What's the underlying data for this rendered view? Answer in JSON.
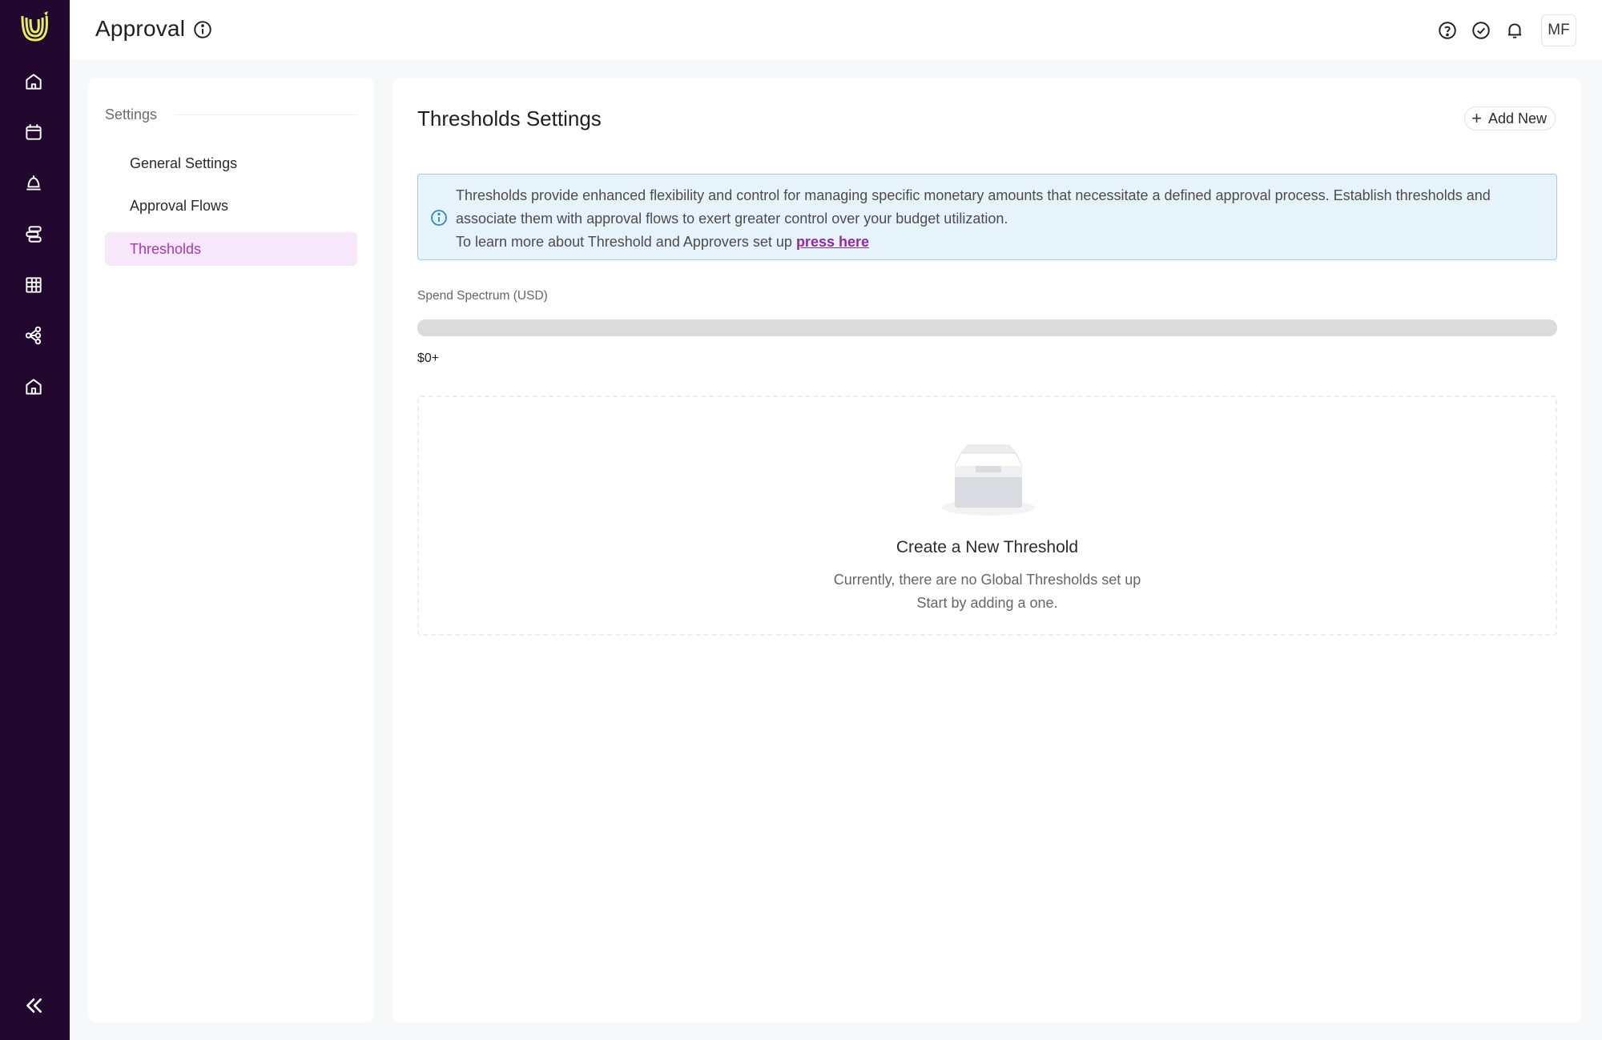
{
  "header": {
    "title": "Approval",
    "avatar_initials": "MF"
  },
  "sidebar": {
    "nav_icons": [
      "home-icon",
      "calendar-icon",
      "bell-stand-icon",
      "stacked-cards-icon",
      "table-icon",
      "share-nodes-icon",
      "building-home-icon"
    ],
    "collapse_icon": "double-chevron-left-icon"
  },
  "settings": {
    "heading": "Settings",
    "items": [
      {
        "label": "General Settings",
        "active": false
      },
      {
        "label": "Approval Flows",
        "active": false
      },
      {
        "label": "Thresholds",
        "active": true
      }
    ]
  },
  "main": {
    "title": "Thresholds Settings",
    "add_button_label": "Add New",
    "info": {
      "line1": "Thresholds provide enhanced flexibility and control for managing specific monetary amounts that necessitate a defined approval process. Establish thresholds and associate them with approval flows to exert greater control over your budget utilization.",
      "line2_prefix": "To learn more about Threshold and Approvers set up ",
      "link_text": "press here"
    },
    "spectrum": {
      "label": "Spend Spectrum (USD)",
      "min_label": "$0+"
    },
    "empty_state": {
      "title": "Create a New Threshold",
      "line1": "Currently, there are no Global Thresholds set up",
      "line2": "Start by adding a one."
    }
  },
  "colors": {
    "rail": "#22082f",
    "accent": "#a33bb2",
    "active_bg": "#f6e7fb",
    "info_bg": "#e7f3fb",
    "info_border": "#9ed0ee",
    "logo": "#e3ef5a"
  }
}
